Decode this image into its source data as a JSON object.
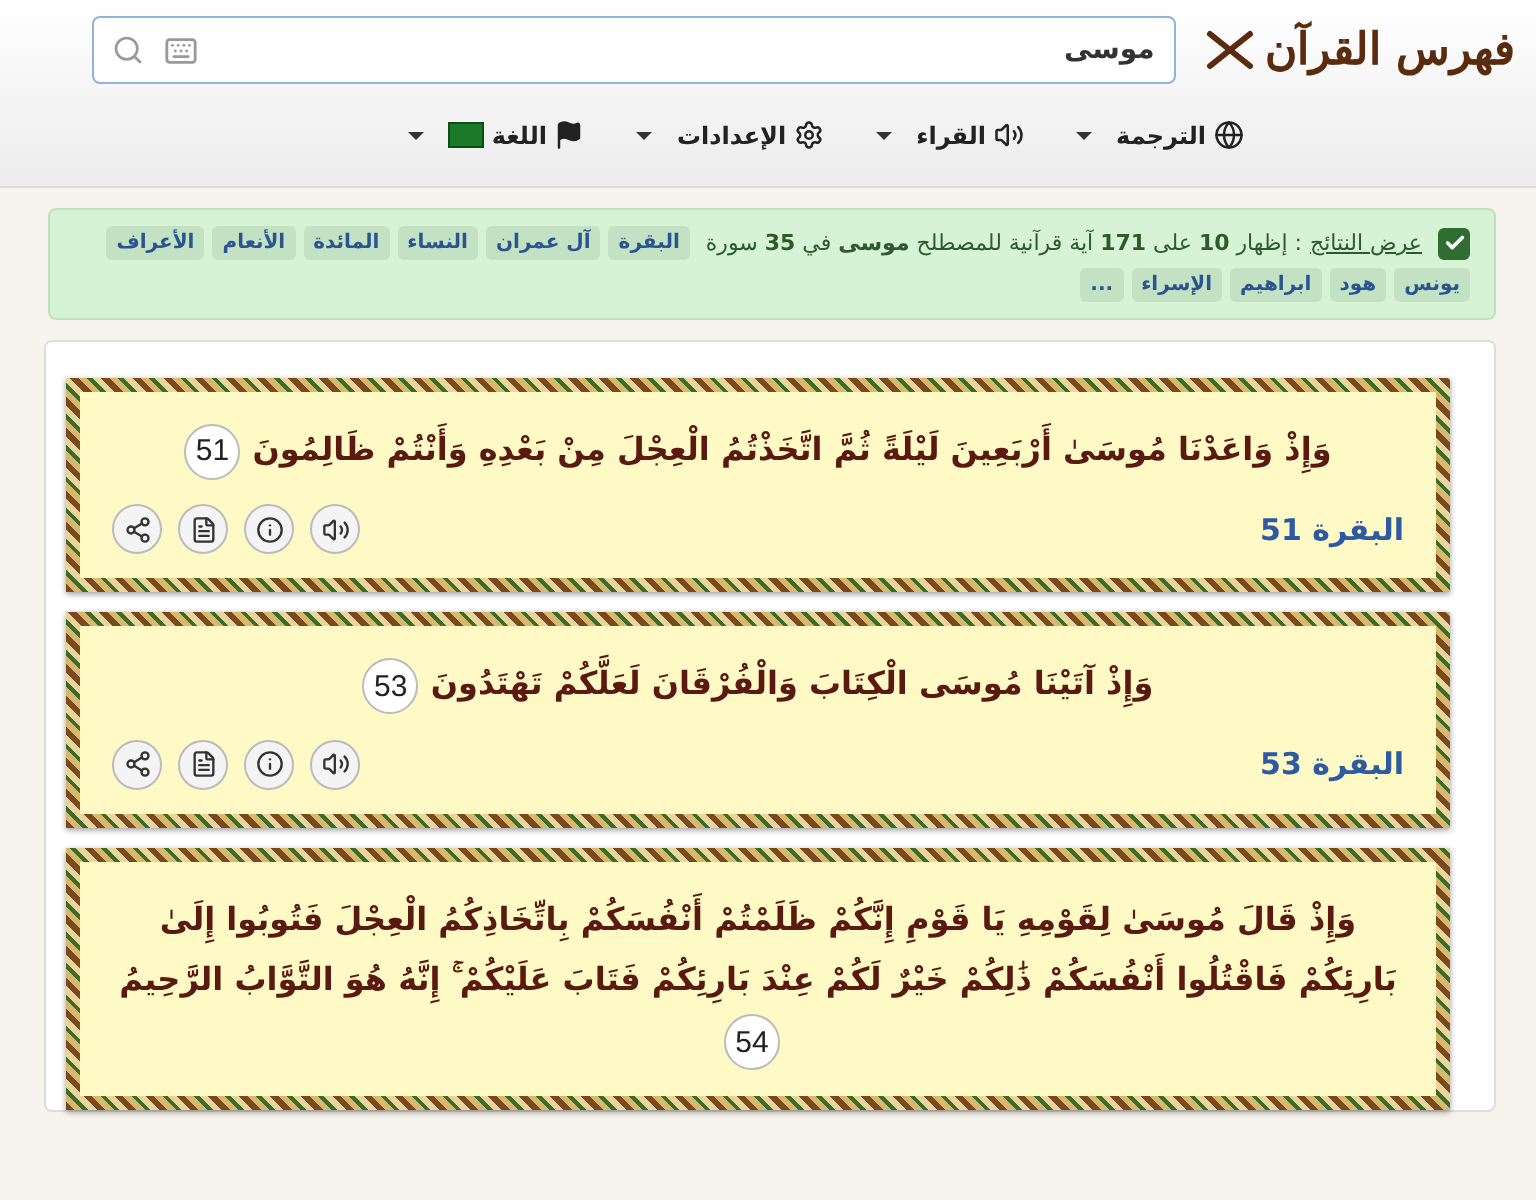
{
  "header": {
    "logo": "فهرس القرآن",
    "search": {
      "value": "موسى"
    }
  },
  "nav": [
    {
      "label": "الترجمة"
    },
    {
      "label": "القراء"
    },
    {
      "label": "الإعدادات"
    },
    {
      "label": "اللغة"
    }
  ],
  "results": {
    "checked": true,
    "link": "عرض النتائج",
    "text": ": إظهار **10** على **171** آية قرآنية للمصطلح **موسى** في **35** سورة",
    "surahs": [
      "البقرة",
      "آل عمران",
      "النساء",
      "المائدة",
      "الأنعام",
      "الأعراف",
      "يونس",
      "هود",
      "ابراهيم",
      "الإسراء",
      "..."
    ]
  },
  "verses": [
    {
      "text": "وَإِذْ وَاعَدْنَا مُوسَىٰ أَرْبَعِينَ لَيْلَةً ثُمَّ اتَّخَذْتُمُ الْعِجْلَ مِنْ بَعْدِهِ وَأَنْتُمْ ظَالِمُونَ",
      "number": "51",
      "reference": "البقرة 51"
    },
    {
      "text": "وَإِذْ آتَيْنَا مُوسَى الْكِتَابَ وَالْفُرْقَانَ لَعَلَّكُمْ تَهْتَدُونَ",
      "number": "53",
      "reference": "البقرة 53"
    },
    {
      "text": "وَإِذْ قَالَ مُوسَىٰ لِقَوْمِهِ يَا قَوْمِ إِنَّكُمْ ظَلَمْتُمْ أَنْفُسَكُمْ بِاتِّخَاذِكُمُ الْعِجْلَ فَتُوبُوا إِلَىٰ بَارِئِكُمْ فَاقْتُلُوا أَنْفُسَكُمْ ذَٰلِكُمْ خَيْرٌ لَكُمْ عِنْدَ بَارِئِكُمْ فَتَابَ عَلَيْكُمْ ۚ إِنَّهُ هُوَ التَّوَّابُ الرَّحِيمُ",
      "number": "54"
    }
  ]
}
